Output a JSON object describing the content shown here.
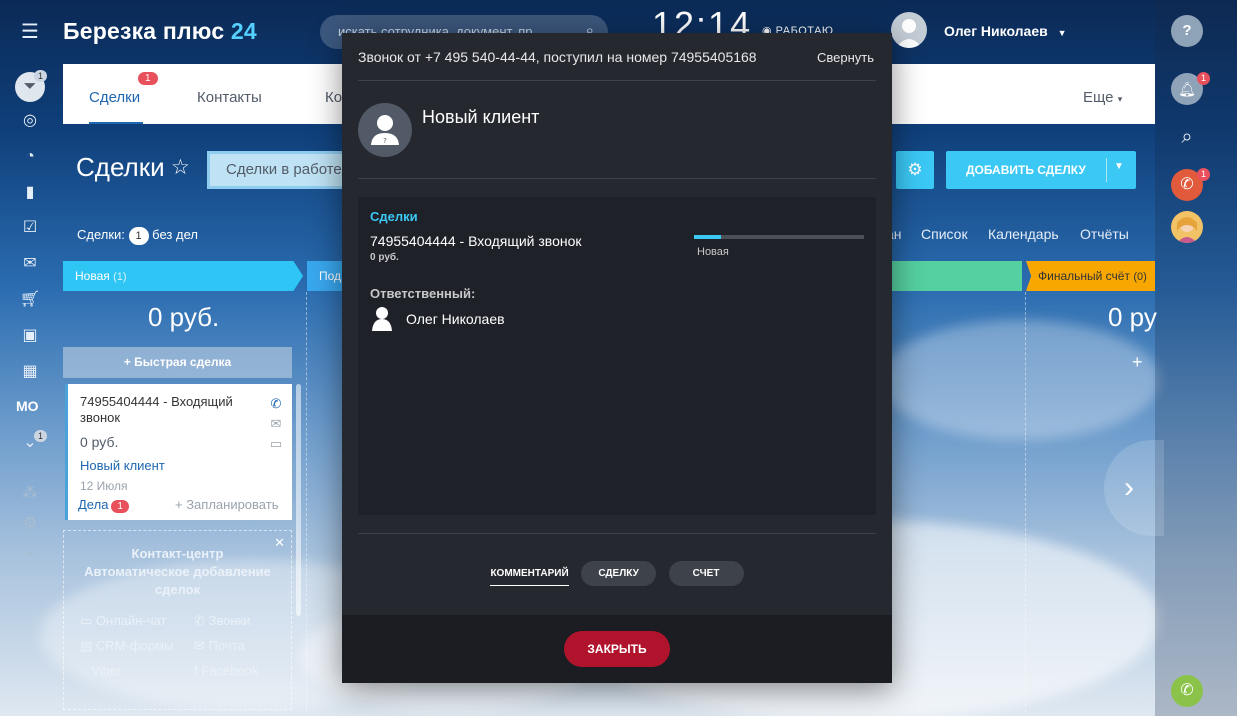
{
  "header": {
    "logo_main": "Березка плюс",
    "logo_num": "24",
    "search_placeholder": "искать сотрудника, документ, пр",
    "clock": "12:14",
    "work_status": "РАБОТАЮ",
    "user_name": "Олег Николаев"
  },
  "left_rail": {
    "badge_top": "1",
    "mo_label": "МО",
    "badge_bottom": "1"
  },
  "crm_tabs": {
    "deals": "Сделки",
    "deals_badge": "1",
    "contacts": "Контакты",
    "companies": "Ко",
    "more": "Еще"
  },
  "page": {
    "title": "Сделки",
    "filter": "Сделки в работе",
    "add_deal": "ДОБАВИТЬ СДЕЛКУ",
    "deals_label": "Сделки:",
    "deals_count": "1",
    "deals_suffix": "без дел"
  },
  "view_links": [
    "ан",
    "Список",
    "Календарь",
    "Отчёты"
  ],
  "columns": [
    {
      "name": "Новая",
      "count": "(1)",
      "sum": "0 руб.",
      "color": "#2fc6f6"
    },
    {
      "name": "Под",
      "count": "",
      "sum": "",
      "color": "#39a8ef"
    },
    {
      "name": "Финальный счёт",
      "count": "(0)",
      "sum": "0 ру",
      "color": "#f7a700"
    }
  ],
  "quick_deal": "Быстрая сделка",
  "deal_card": {
    "title": "74955404444 - Входящий звонок",
    "sum": "0 руб.",
    "client": "Новый клиент",
    "date": "12 Июля",
    "tasks_label": "Дела",
    "tasks_count": "1",
    "plan": "+ Запланировать"
  },
  "contact_center": {
    "title_1": "Контакт-центр",
    "title_2": "Автоматическое добавление",
    "title_3": "сделок",
    "items": [
      "Онлайн-чат",
      "Звонки",
      "CRM-формы",
      "Почта",
      "Viber",
      "Facebook"
    ]
  },
  "modal": {
    "call_info": "Звонок от +7 495 540-44-44, поступил на номер 74955405168",
    "collapse": "Свернуть",
    "client": "Новый клиент",
    "section_label": "Сделки",
    "deal_title": "74955404444 - Входящий звонок",
    "deal_sum": "0 руб.",
    "stage": "Новая",
    "stage_progress": 0.16,
    "responsible_label": "Ответственный:",
    "responsible_name": "Олег Николаев",
    "action_comment": "КОММЕНТАРИЙ",
    "action_deal": "СДЕЛКУ",
    "action_invoice": "СЧЕТ",
    "close": "ЗАКРЫТЬ"
  },
  "right_rail": {
    "notify_badge": "1",
    "call_badge": "1"
  },
  "colors": {
    "accent": "#3bc8f5",
    "link": "#2067b0",
    "close_button": "#b0132c",
    "modal_bg": "#25282f"
  }
}
